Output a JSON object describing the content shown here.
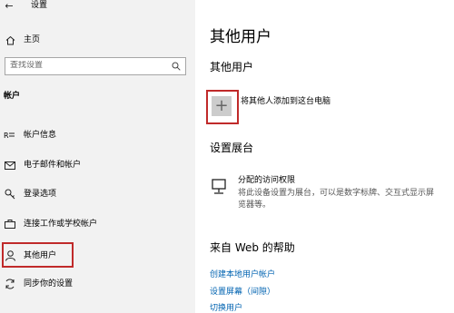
{
  "titlebar": {
    "back_icon": "←",
    "title": "设置"
  },
  "sidebar": {
    "home": {
      "icon": "home-icon",
      "label": "主页"
    },
    "search": {
      "placeholder": "查找设置"
    },
    "section": "帐户",
    "items": [
      {
        "id": "account-info",
        "icon": "person-card-icon",
        "label": "帐户信息"
      },
      {
        "id": "email-accounts",
        "icon": "mail-icon",
        "label": "电子邮件和帐户"
      },
      {
        "id": "signin-options",
        "icon": "key-icon",
        "label": "登录选项"
      },
      {
        "id": "work-school",
        "icon": "briefcase-icon",
        "label": "连接工作或学校帐户"
      },
      {
        "id": "other-users",
        "icon": "person-icon",
        "label": "其他用户",
        "selected": true
      },
      {
        "id": "sync",
        "icon": "sync-icon",
        "label": "同步你的设置"
      }
    ]
  },
  "main": {
    "page_title": "其他用户",
    "section_other": "其他用户",
    "add_user_label": "将其他人添加到这台电脑",
    "kiosk_heading": "设置展台",
    "kiosk_title": "分配的访问权限",
    "kiosk_desc_1": "将此设备设置为展台，可以是数字标牌、交互式显示屏",
    "kiosk_desc_2": "览器等。",
    "help_heading": "来自 Web 的帮助",
    "help_links": [
      "创建本地用户帐户",
      "设置屏幕（间隙）",
      "切换用户"
    ]
  },
  "colors": {
    "accent_link": "#0063b1",
    "highlight": "#c02a2a",
    "sidebar_bg": "#f2f2f2"
  }
}
